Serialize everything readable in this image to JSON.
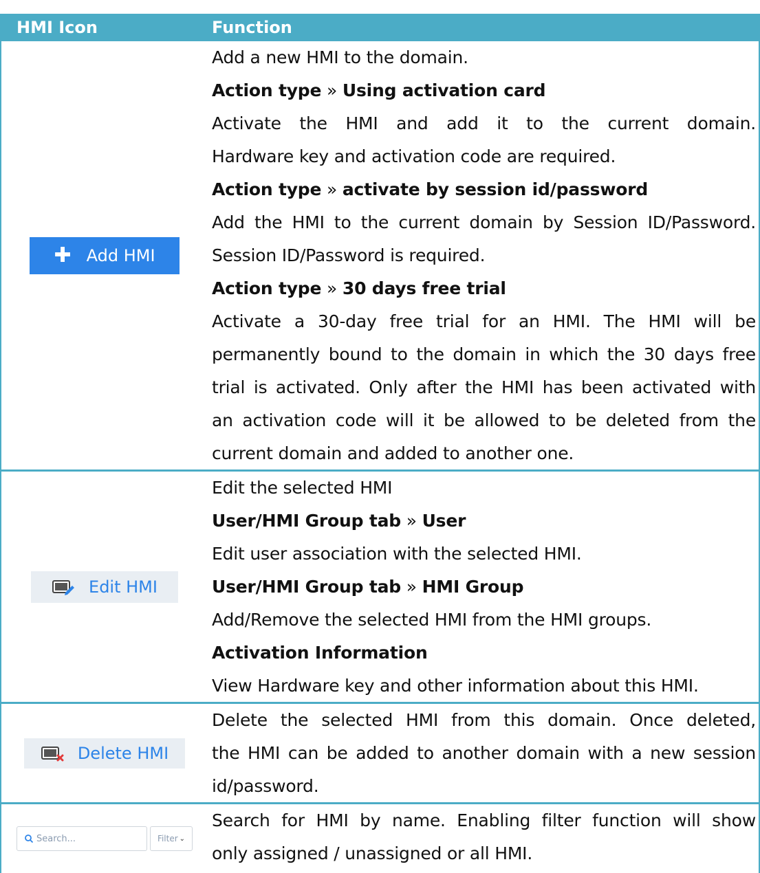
{
  "header": {
    "col1": "HMI Icon",
    "col2": "Function"
  },
  "rows": {
    "add": {
      "button_label": "Add HMI",
      "l1": "Add a new HMI to the domain.",
      "l2_a": "Action type",
      "sep": "»",
      "l2_b": "Using activation card",
      "l3": "Activate the HMI and add it to the current domain.",
      "l4": "Hardware key and activation code are required.",
      "l5_a": "Action type",
      "l5_b": "activate by session id/password",
      "l6": "Add the HMI to the current domain by Session ID/Password.",
      "l7": "Session ID/Password is required.",
      "l8_a": "Action type",
      "l8_b": "30 days free trial",
      "l9": "Activate a 30-day free trial for an HMI. The HMI will be",
      "l10": "permanently bound to the domain in which the 30 days free",
      "l11": "trial is activated. Only after the HMI has been activated with",
      "l12": "an activation code will it be allowed to be deleted from the",
      "l13": "current domain and added to another one."
    },
    "edit": {
      "button_label": "Edit HMI",
      "l1": "Edit the selected HMI",
      "l2_a": "User/HMI Group tab",
      "l2_b": "User",
      "l3": "Edit user association with the selected HMI.",
      "l4_a": "User/HMI Group tab",
      "l4_b": "HMI Group",
      "l5": "Add/Remove the selected HMI from the HMI groups.",
      "l6": "Activation Information",
      "l7": "View Hardware key and other information about this HMI."
    },
    "delete": {
      "button_label": "Delete HMI",
      "l1": "Delete the selected HMI from this domain. Once deleted,",
      "l2": "the HMI can be added to another domain with a new session",
      "l3": "id/password."
    },
    "search": {
      "placeholder": "Search...",
      "filter_label": "Filter",
      "l1": "Search for HMI by name. Enabling filter function will show",
      "l2": "only assigned / unassigned or all HMI."
    }
  },
  "colors": {
    "header_bg": "#4bacc6",
    "accent": "#2d84e8"
  }
}
